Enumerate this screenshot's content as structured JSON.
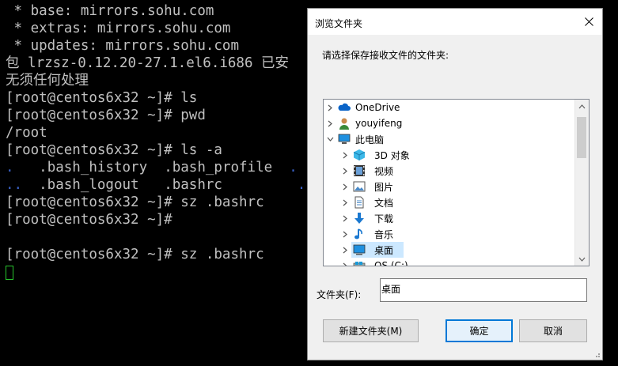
{
  "terminal": {
    "lines": [
      " * base: mirrors.sohu.com",
      " * extras: mirrors.sohu.com",
      " * updates: mirrors.sohu.com",
      "包 lrzsz-0.12.20-27.1.el6.i686 已安",
      "无须任何处理",
      "[root@centos6x32 ~]# ls",
      "[root@centos6x32 ~]# pwd",
      "/root",
      "[root@centos6x32 ~]# ls -a",
      "",
      "",
      "[root@centos6x32 ~]# sz .bashrc",
      "[root@centos6x32 ~]#",
      "",
      "[root@centos6x32 ~]# sz .bashrc"
    ],
    "ls_row1": {
      "dir": ".",
      "files": "   .bash_history  .bash_profile  ",
      "trail": "."
    },
    "ls_row2": {
      "dir": "..",
      "files": "  .bash_logout   .bashrc         ",
      "trail": "."
    },
    "colors": {
      "text": "#c0c0c0",
      "dir": "#3a62c8",
      "cursor": "#27c22c",
      "background": "#000000"
    }
  },
  "dialog": {
    "title": "浏览文件夹",
    "prompt": "请选择保存接收文件的文件夹:",
    "tree": [
      {
        "label": "OneDrive",
        "icon": "cloud-icon",
        "expanded": false
      },
      {
        "label": "youyifeng",
        "icon": "user-icon",
        "expanded": false
      },
      {
        "label": "此电脑",
        "icon": "computer-icon",
        "expanded": true
      },
      {
        "label": "3D 对象",
        "icon": "3d-objects-icon",
        "expanded": false
      },
      {
        "label": "视频",
        "icon": "video-icon",
        "expanded": false
      },
      {
        "label": "图片",
        "icon": "pictures-icon",
        "expanded": false
      },
      {
        "label": "文档",
        "icon": "documents-icon",
        "expanded": false
      },
      {
        "label": "下载",
        "icon": "download-icon",
        "expanded": false
      },
      {
        "label": "音乐",
        "icon": "music-icon",
        "expanded": false
      },
      {
        "label": "桌面",
        "icon": "desktop-icon",
        "expanded": false,
        "selected": true
      },
      {
        "label": "OS (C:)",
        "icon": "drive-icon",
        "expanded": false
      }
    ],
    "folder_label": "文件夹(F):",
    "folder_value": "桌面",
    "buttons": {
      "new_folder": "新建文件夹(M)",
      "ok": "确定",
      "cancel": "取消"
    },
    "colors": {
      "accent": "#0078d7",
      "selection": "#cce8ff"
    }
  }
}
